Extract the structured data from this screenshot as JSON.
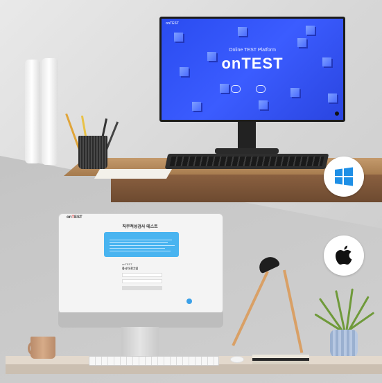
{
  "top_screen": {
    "brand": "onTEST",
    "nav": "",
    "subtitle": "Online TEST Platform",
    "logo": "onTEST",
    "small_text": "",
    "button_primary": "",
    "button_secondary": ""
  },
  "bottom_screen": {
    "brand_prefix": "on",
    "brand_accent": "T",
    "brand_suffix": "EST",
    "title": "직무적성검사 테스트",
    "notice_title": "",
    "login_label": "onTEST",
    "login_heading": "응시자 로그인",
    "field_1_placeholder": "",
    "field_2_placeholder": "",
    "footer": ""
  },
  "badges": {
    "windows": "windows-icon",
    "apple": "apple-icon"
  },
  "colors": {
    "screen_blue": "#3b5cff",
    "notice_blue": "#49b4f0",
    "accent_red": "#e64040"
  }
}
